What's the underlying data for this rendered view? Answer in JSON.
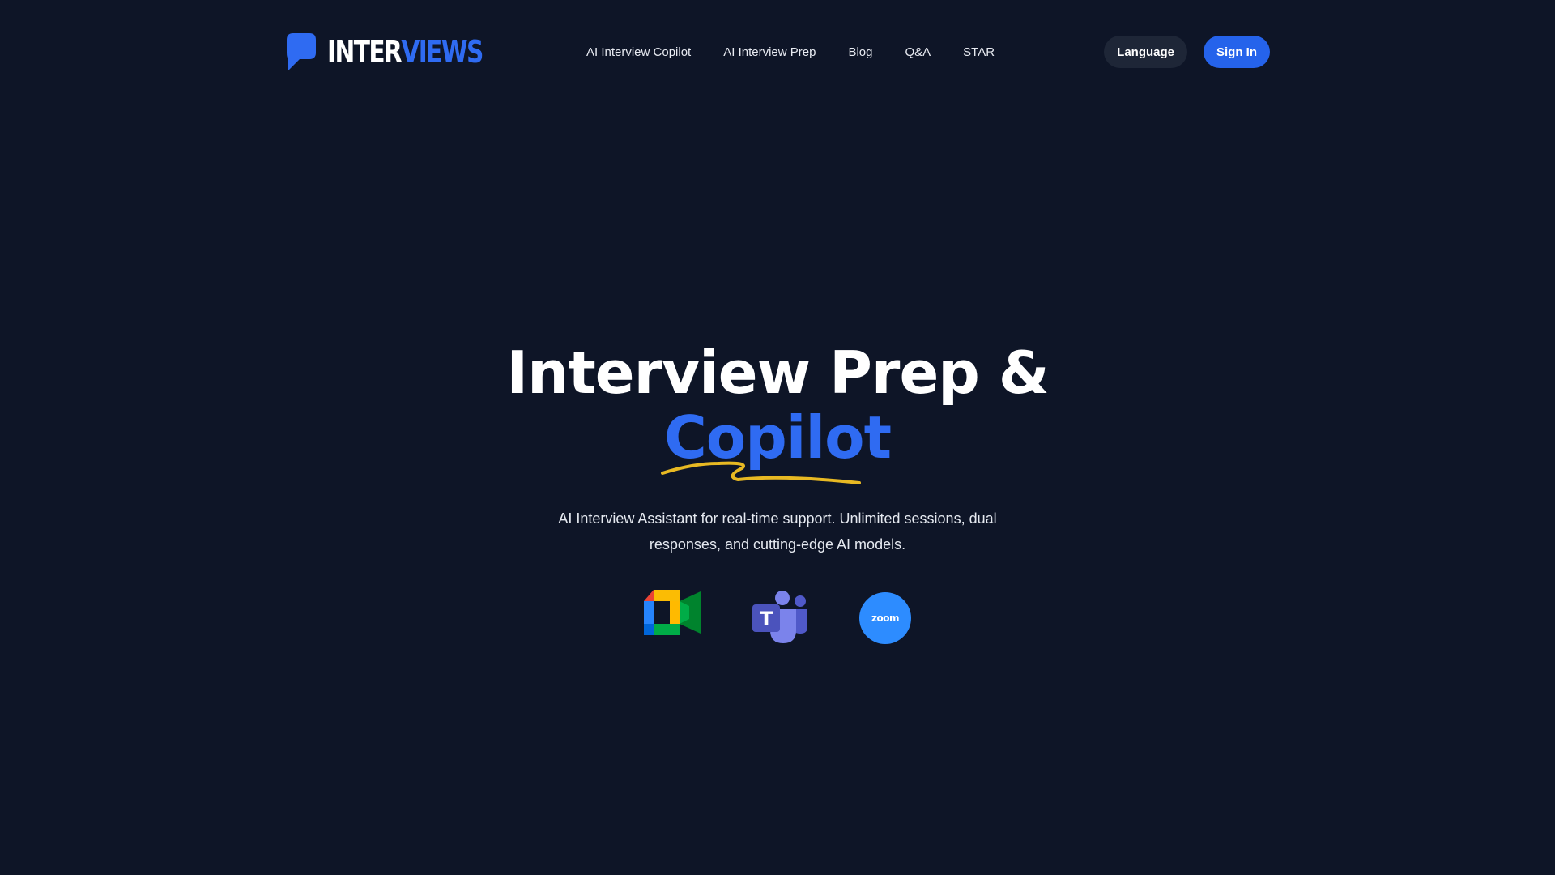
{
  "brand": {
    "name_part1": "INTER",
    "name_part2": "VIEWS",
    "accent_color": "#2f6bf2",
    "background_color": "#0e1527"
  },
  "nav": {
    "items": [
      {
        "label": "AI Interview Copilot"
      },
      {
        "label": "AI Interview Prep"
      },
      {
        "label": "Blog"
      },
      {
        "label": "Q&A"
      },
      {
        "label": "STAR"
      }
    ]
  },
  "actions": {
    "language_label": "Language",
    "signin_label": "Sign In",
    "signin_color": "#2563eb"
  },
  "hero": {
    "title_line1": "Interview Prep &",
    "title_line2": "Copilot",
    "underline_color": "#e8b923",
    "subtitle": "AI Interview Assistant for real-time support. Unlimited sessions, dual responses, and cutting-edge AI models."
  },
  "platforms": [
    {
      "icon": "google-meet-icon"
    },
    {
      "icon": "microsoft-teams-icon"
    },
    {
      "icon": "zoom-icon",
      "label": "zoom"
    }
  ]
}
